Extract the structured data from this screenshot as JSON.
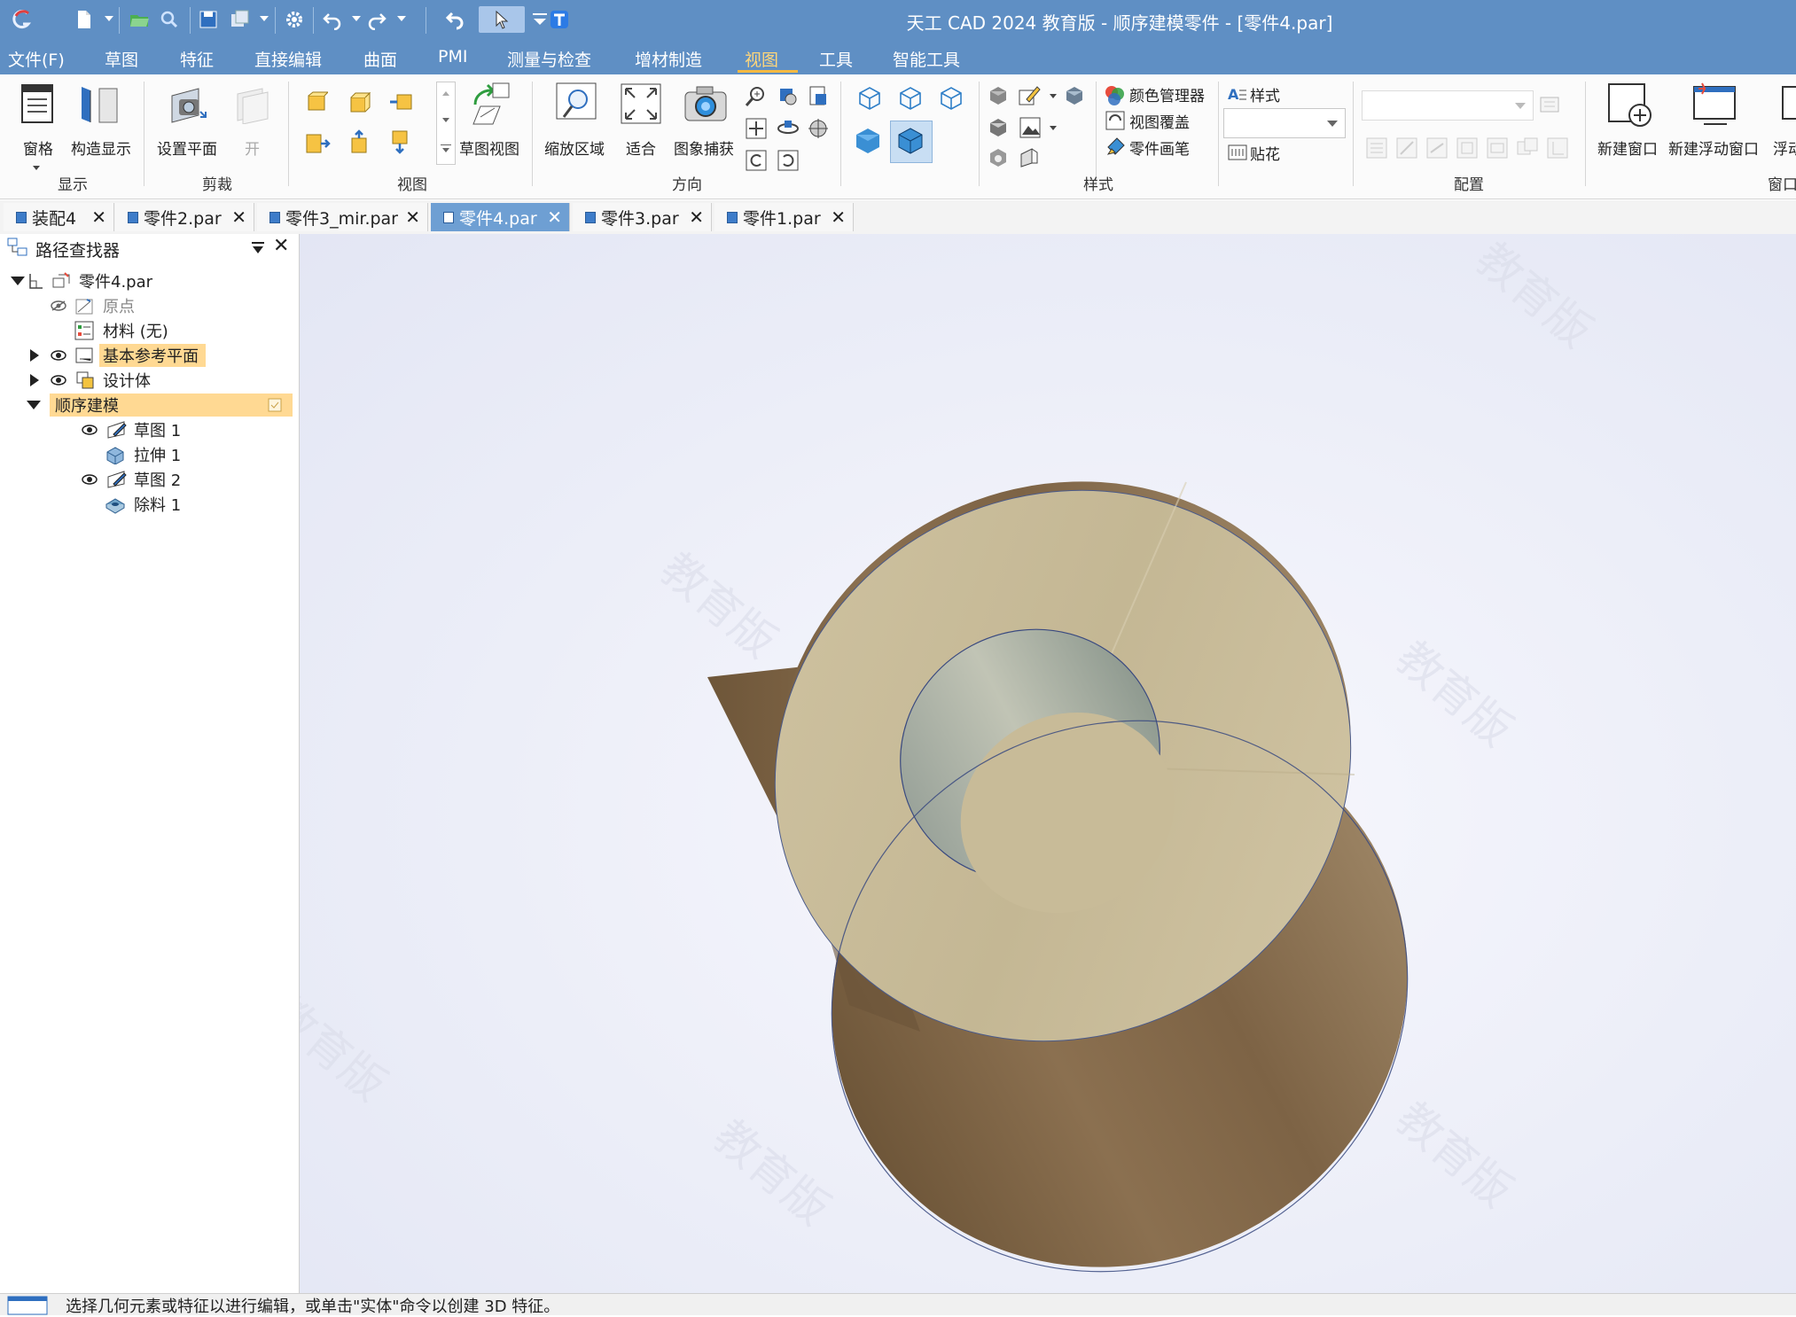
{
  "window": {
    "title": "天工 CAD 2024 教育版 - 顺序建模零件 - [零件4.par]"
  },
  "menu": {
    "items": [
      "文件(F)",
      "草图",
      "特征",
      "直接编辑",
      "曲面",
      "PMI",
      "测量与检查",
      "增材制造",
      "视图",
      "工具",
      "智能工具"
    ],
    "active": "视图"
  },
  "ribbon": {
    "display": {
      "label": "显示",
      "pane": "窗格",
      "construct_display": "构造显示"
    },
    "clip": {
      "label": "剪裁",
      "set_plane": "设置平面",
      "open": "开"
    },
    "view": {
      "label": "视图",
      "sketch_view": "草图视图"
    },
    "orient": {
      "label": "方向",
      "zoom_area": "缩放区域",
      "fit": "适合",
      "image_capture": "图象捕获"
    },
    "style": {
      "label": "样式",
      "color_manager": "颜色管理器",
      "view_override": "视图覆盖",
      "part_painter": "零件画笔",
      "styles": "样式",
      "decal": "贴花"
    },
    "config": {
      "label": "配置"
    },
    "window": {
      "label": "窗口",
      "new_window": "新建窗口",
      "new_float_window": "新建浮动窗口",
      "float": "浮动"
    }
  },
  "tabs": [
    {
      "label": "装配4",
      "active": false
    },
    {
      "label": "零件2.par",
      "active": false
    },
    {
      "label": "零件3_mir.par",
      "active": false
    },
    {
      "label": "零件4.par",
      "active": true
    },
    {
      "label": "零件3.par",
      "active": false
    },
    {
      "label": "零件1.par",
      "active": false
    }
  ],
  "pathfinder": {
    "title": "路径查找器",
    "root": "零件4.par",
    "origin": "原点",
    "material": "材料 (无)",
    "base_planes": "基本参考平面",
    "design_body": "设计体",
    "ordered": "顺序建模",
    "features": [
      "草图 1",
      "拉伸 1",
      "草图 2",
      "除料 1"
    ]
  },
  "watermark": "教育版",
  "status": {
    "message": "选择几何元素或特征以进行编辑，或单击\"实体\"命令以创建 3D 特征。"
  },
  "colors": {
    "titlebar": "#5f8fc4",
    "active_tab": "#6e9fd3",
    "highlight": "#ffd993",
    "body_top": "#cbbf9b",
    "body_side": "#8a7052"
  }
}
